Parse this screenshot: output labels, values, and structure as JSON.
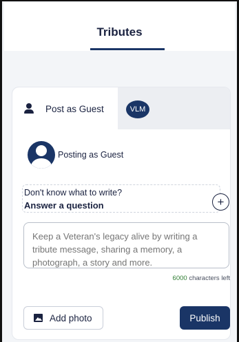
{
  "header": {
    "title": "Tributes"
  },
  "tabs": [
    {
      "label": "Post as Guest",
      "icon": "person-icon",
      "selected": true
    },
    {
      "label": "VLM",
      "icon": "vlm-avatar"
    }
  ],
  "posting": {
    "label": "Posting as Guest",
    "icon": "guest-avatar-icon"
  },
  "question": {
    "prompt": "Don't know what to write?",
    "action": "Answer a question",
    "icon": "plus-circle-icon"
  },
  "message": {
    "placeholder": "Keep a Veteran's legacy alive by writing a tribute message, sharing a memory, a photograph, a story and more.",
    "value": ""
  },
  "char_counter": {
    "count": "6000",
    "suffix": "characters left"
  },
  "actions": {
    "add_photo": "Add photo",
    "add_photo_icon": "image-icon",
    "publish": "Publish"
  },
  "colors": {
    "primary": "#1a3566",
    "counter_green": "#2e7d32",
    "background": "#f3f5f8"
  }
}
